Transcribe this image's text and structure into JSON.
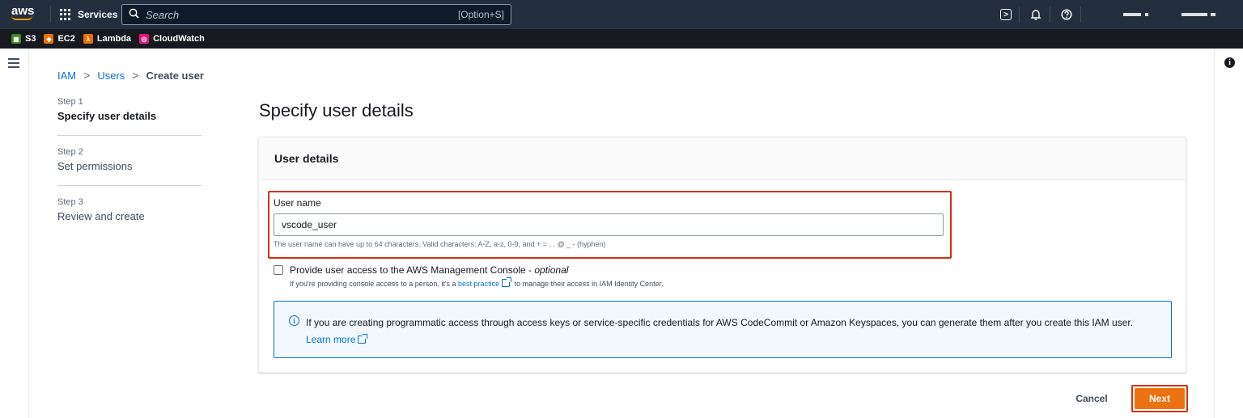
{
  "topnav": {
    "logo": "aws",
    "services_label": "Services",
    "search_placeholder": "Search",
    "search_shortcut": "[Option+S]"
  },
  "favorites": [
    {
      "label": "S3",
      "color": "#3f8624",
      "glyph": "▣"
    },
    {
      "label": "EC2",
      "color": "#ed7100",
      "glyph": "◈"
    },
    {
      "label": "Lambda",
      "color": "#ed7100",
      "glyph": "λ"
    },
    {
      "label": "CloudWatch",
      "color": "#e7157b",
      "glyph": "◎"
    }
  ],
  "breadcrumb": {
    "items": [
      "IAM",
      "Users"
    ],
    "current": "Create user",
    "separator": ">"
  },
  "steps": [
    {
      "num": "Step 1",
      "title": "Specify user details"
    },
    {
      "num": "Step 2",
      "title": "Set permissions"
    },
    {
      "num": "Step 3",
      "title": "Review and create"
    }
  ],
  "page": {
    "title": "Specify user details",
    "section_title": "User details"
  },
  "user_name": {
    "label": "User name",
    "value": "vscode_user",
    "hint": "The user name can have up to 64 characters. Valid characters: A-Z, a-z, 0-9, and + = , . @ _ - (hyphen)"
  },
  "console_access": {
    "label": "Provide user access to the AWS Management Console - ",
    "optional": "optional",
    "desc_prefix": "If you're providing console access to a person, it's a ",
    "desc_link": "best practice",
    "desc_suffix": " to manage their access in IAM Identity Center."
  },
  "alert": {
    "text": "If you are creating programmatic access through access keys or service-specific credentials for AWS CodeCommit or Amazon Keyspaces, you can generate them after you create this IAM user. ",
    "link": "Learn more"
  },
  "actions": {
    "cancel": "Cancel",
    "next": "Next"
  },
  "colors": {
    "nav_bg": "#232f3e",
    "primary_button": "#ec7211",
    "link": "#0972d3",
    "highlight": "#d13212"
  }
}
